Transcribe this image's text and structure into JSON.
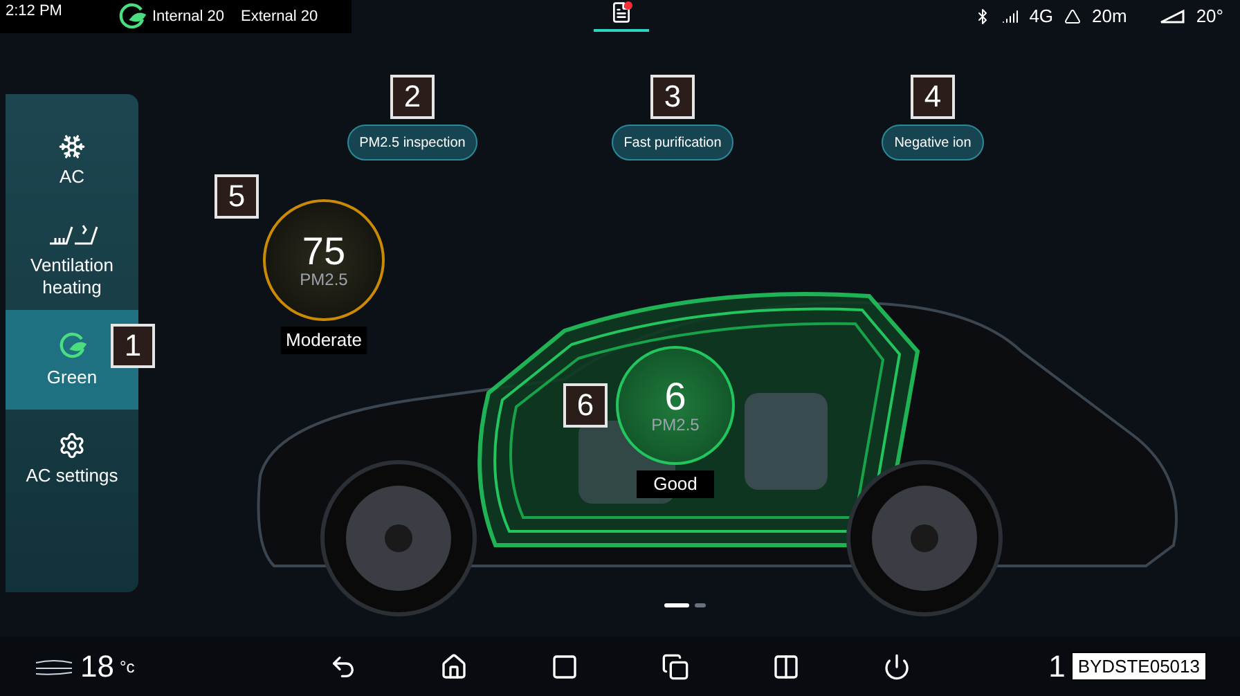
{
  "status_bar": {
    "time": "2:12 PM",
    "temps": [
      "Internal 20",
      "External 20"
    ],
    "network": "4G",
    "altitude": "20m",
    "outside": "20°",
    "notification": true
  },
  "sidebar": {
    "items": [
      {
        "kind": "ac",
        "label": "AC",
        "selected": false
      },
      {
        "kind": "seat",
        "label": "Ventilation heating",
        "selected": false
      },
      {
        "kind": "green",
        "label": "Green",
        "selected": true
      },
      {
        "kind": "settings",
        "label": "AC settings",
        "selected": false
      }
    ]
  },
  "features": [
    {
      "label": "PM2.5 inspection",
      "callout": "2"
    },
    {
      "label": "Fast purification",
      "callout": "3"
    },
    {
      "label": "Negative ion",
      "callout": "4"
    }
  ],
  "outside_gauge": {
    "value": "75",
    "unit": "PM2.5",
    "rating": "Moderate",
    "callout": "5"
  },
  "cabin_gauge": {
    "value": "6",
    "unit": "PM2.5",
    "rating": "Good",
    "callout": "6"
  },
  "sidebar_callout": "1",
  "pages": [
    {
      "selected": true
    },
    {
      "selected": false
    }
  ],
  "bottom_bar": {
    "left_temp": "18",
    "left_unit": "°c",
    "right_temp": "1"
  },
  "figure_code": "BYDSTE05013"
}
